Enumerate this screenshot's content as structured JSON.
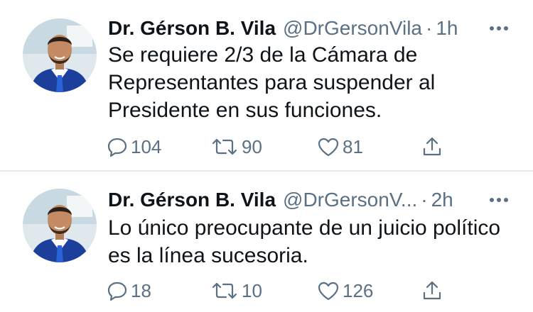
{
  "tweets": [
    {
      "author_name": "Dr. Gérson B. Vila",
      "handle": "@DrGersonVila",
      "separator": "·",
      "time": "1h",
      "text": "Se requiere 2/3 de la Cámara de Representantes para suspender al Presidente en sus funciones.",
      "replies": "104",
      "retweets": "90",
      "likes": "81"
    },
    {
      "author_name": "Dr. Gérson B. Vila",
      "handle": "@DrGersonV...",
      "separator": "·",
      "time": "2h",
      "text": "Lo único preocupante de un juicio político es la línea sucesoria.",
      "replies": "18",
      "retweets": "10",
      "likes": "126"
    }
  ],
  "icons": {
    "more": "more-horizontal-icon",
    "reply": "reply-icon",
    "retweet": "retweet-icon",
    "like": "heart-icon",
    "share": "share-icon"
  },
  "colors": {
    "text_primary": "#0f1419",
    "text_secondary": "#5b7083",
    "divider": "#e6e9ec",
    "avatar_background": "#dfe8ec",
    "suit": "#1d3f9c",
    "tie": "#2a63d9"
  }
}
